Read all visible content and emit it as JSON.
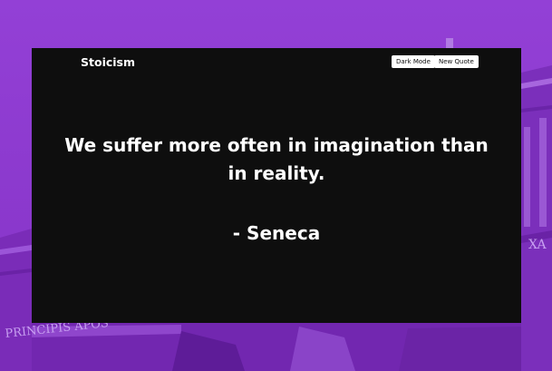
{
  "nav": {
    "brand": "Stoicism",
    "dark_mode_label": "Dark Mode",
    "new_quote_label": "New Quote"
  },
  "quote": {
    "text": "We suffer more often in imagination than in reality.",
    "author": "- Seneca"
  },
  "background": {
    "inscription_text": "PRINCIPIS APOS",
    "inscription_right": "XA"
  },
  "colors": {
    "background_tint": "#8a3ad0",
    "card": "#0e0e0e",
    "text": "#ffffff",
    "button_bg": "#ffffff",
    "button_text": "#111111"
  }
}
